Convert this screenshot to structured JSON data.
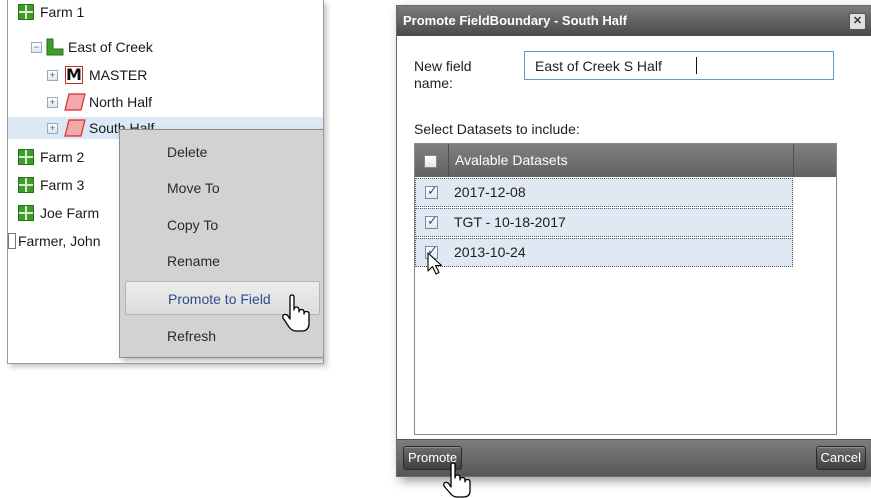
{
  "tree": {
    "items": [
      {
        "label": "Farm 1",
        "icon": "farm-icon"
      },
      {
        "label": "East of Creek",
        "icon": "field-icon"
      },
      {
        "label": "MASTER",
        "icon": "master-icon",
        "badge": "M"
      },
      {
        "label": "North Half",
        "icon": "boundary-icon"
      },
      {
        "label": "South Half",
        "icon": "boundary-icon"
      },
      {
        "label": "Farm 2",
        "icon": "farm-icon"
      },
      {
        "label": "Farm 3",
        "icon": "farm-icon"
      },
      {
        "label": "Joe Farm",
        "icon": "farm-icon"
      },
      {
        "label": "Farmer, John",
        "icon": "farmer-icon"
      }
    ],
    "toggle_collapsed": "+",
    "toggle_expanded": "−"
  },
  "context_menu": {
    "items": [
      {
        "label": "Delete"
      },
      {
        "label": "Move To"
      },
      {
        "label": "Copy To"
      },
      {
        "label": "Rename"
      },
      {
        "label": "Promote to Field"
      },
      {
        "label": "Refresh"
      }
    ],
    "hovered": "Promote to Field"
  },
  "dialog": {
    "title": "Promote FieldBoundary - South Half",
    "close_symbol": "✕",
    "name_label": "New field name:",
    "name_value": "East of Creek S Half",
    "datasets_label": "Select Datasets to include:",
    "grid_header": "Avalable Datasets",
    "datasets": [
      {
        "label": "2017-12-08",
        "checked": true
      },
      {
        "label": "TGT - 10-18-2017",
        "checked": true
      },
      {
        "label": "2013-10-24",
        "checked": true
      }
    ],
    "promote_label": "Promote",
    "cancel_label": "Cancel"
  },
  "colors": {
    "farm_icon": "#3f9c2a",
    "boundary_fill": "#f3a9a9",
    "boundary_stroke": "#d03030",
    "selection_row": "#dce8f6",
    "dialog_title": "#5a5a5a",
    "input_border": "#5b9bd5"
  }
}
